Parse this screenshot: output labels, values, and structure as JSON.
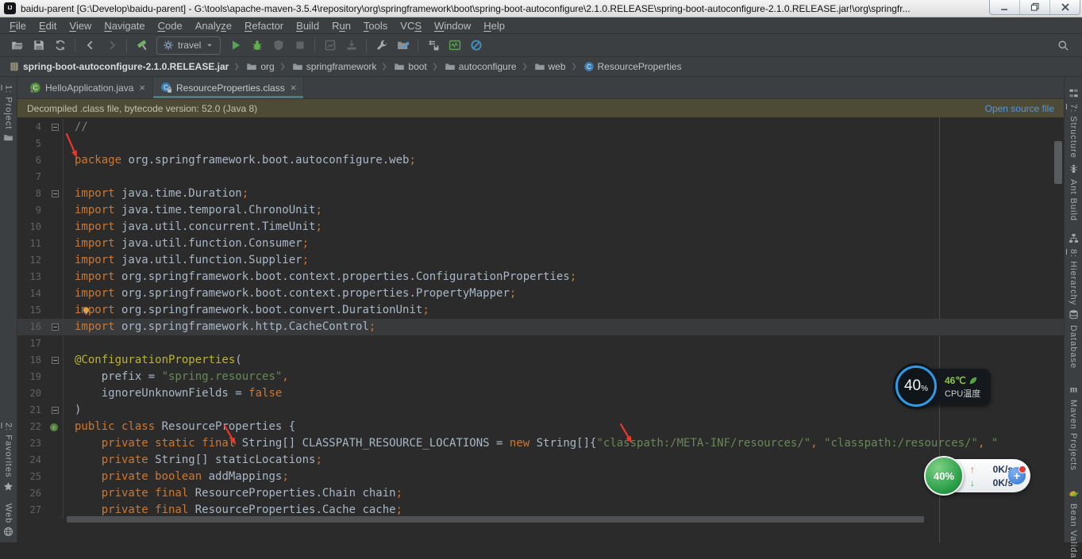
{
  "window": {
    "app_badge": "IJ",
    "title": "baidu-parent [G:\\Develop\\baidu-parent] - G:\\tools\\apache-maven-3.5.4\\repository\\org\\springframework\\boot\\spring-boot-autoconfigure\\2.1.0.RELEASE\\spring-boot-autoconfigure-2.1.0.RELEASE.jar!\\org\\springfr...",
    "controls": [
      "minimize",
      "maximize",
      "close"
    ]
  },
  "menu": {
    "items": [
      {
        "label": "File",
        "mnemonic_index": 0
      },
      {
        "label": "Edit",
        "mnemonic_index": 0
      },
      {
        "label": "View",
        "mnemonic_index": 0
      },
      {
        "label": "Navigate",
        "mnemonic_index": 0
      },
      {
        "label": "Code",
        "mnemonic_index": 0
      },
      {
        "label": "Analyze",
        "mnemonic_index": 5
      },
      {
        "label": "Refactor",
        "mnemonic_index": 0
      },
      {
        "label": "Build",
        "mnemonic_index": 0
      },
      {
        "label": "Run",
        "mnemonic_index": 1
      },
      {
        "label": "Tools",
        "mnemonic_index": 0
      },
      {
        "label": "VCS",
        "mnemonic_index": 2
      },
      {
        "label": "Window",
        "mnemonic_index": 0
      },
      {
        "label": "Help",
        "mnemonic_index": 0
      }
    ]
  },
  "toolbar": {
    "run_config_label": "travel",
    "items": [
      {
        "name": "open-project"
      },
      {
        "name": "save-all"
      },
      {
        "name": "synchronize"
      },
      {
        "sep": true
      },
      {
        "name": "back"
      },
      {
        "name": "forward",
        "enabled": false
      },
      {
        "sep": true
      },
      {
        "name": "build-hammer"
      },
      {
        "name": "run-config"
      },
      {
        "name": "run"
      },
      {
        "name": "debug"
      },
      {
        "name": "run-coverage",
        "enabled": false
      },
      {
        "name": "stop",
        "enabled": false
      },
      {
        "sep": true
      },
      {
        "name": "attach-profiler",
        "enabled": false
      },
      {
        "name": "thread-dump",
        "enabled": false
      },
      {
        "sep": true
      },
      {
        "name": "settings-wrench"
      },
      {
        "name": "project-structure"
      },
      {
        "sep": true
      },
      {
        "name": "push-settings"
      },
      {
        "name": "activity-monitor"
      },
      {
        "name": "disabled-plugins"
      }
    ],
    "search_icon": "search-everywhere"
  },
  "breadcrumbs": {
    "root": {
      "label": "spring-boot-autoconfigure-2.1.0.RELEASE.jar",
      "icon": "jar"
    },
    "folders": [
      "org",
      "springframework",
      "boot",
      "autoconfigure",
      "web"
    ],
    "leaf": {
      "label": "ResourceProperties",
      "icon": "class"
    }
  },
  "tabs": [
    {
      "label": "HelloApplication.java",
      "icon": "class-green",
      "active": false
    },
    {
      "label": "ResourceProperties.class",
      "icon": "class-blue-lock",
      "active": true
    }
  ],
  "banner": {
    "message": "Decompiled .class file, bytecode version: 52.0 (Java 8)",
    "action_label": "Open source file"
  },
  "editor": {
    "caret_line": 16,
    "lines": [
      {
        "n": 4,
        "fold": true,
        "tokens": [
          [
            "c",
            "//"
          ]
        ]
      },
      {
        "n": 5,
        "tokens": []
      },
      {
        "n": 6,
        "tokens": [
          [
            "k",
            "package"
          ],
          [
            "p",
            " org.springframework.boot.autoconfigure.web"
          ],
          [
            "o",
            ";"
          ]
        ]
      },
      {
        "n": 7,
        "tokens": []
      },
      {
        "n": 8,
        "fold": true,
        "tokens": [
          [
            "k",
            "import"
          ],
          [
            "p",
            " java.time.Duration"
          ],
          [
            "o",
            ";"
          ]
        ]
      },
      {
        "n": 9,
        "tokens": [
          [
            "k",
            "import"
          ],
          [
            "p",
            " java.time.temporal.ChronoUnit"
          ],
          [
            "o",
            ";"
          ]
        ]
      },
      {
        "n": 10,
        "tokens": [
          [
            "k",
            "import"
          ],
          [
            "p",
            " java.util.concurrent.TimeUnit"
          ],
          [
            "o",
            ";"
          ]
        ]
      },
      {
        "n": 11,
        "tokens": [
          [
            "k",
            "import"
          ],
          [
            "p",
            " java.util.function.Consumer"
          ],
          [
            "o",
            ";"
          ]
        ]
      },
      {
        "n": 12,
        "tokens": [
          [
            "k",
            "import"
          ],
          [
            "p",
            " java.util.function.Supplier"
          ],
          [
            "o",
            ";"
          ]
        ]
      },
      {
        "n": 13,
        "tokens": [
          [
            "k",
            "import"
          ],
          [
            "p",
            " org.springframework.boot.context.properties.ConfigurationProperties"
          ],
          [
            "o",
            ";"
          ]
        ]
      },
      {
        "n": 14,
        "tokens": [
          [
            "k",
            "import"
          ],
          [
            "p",
            " org.springframework.boot.context.properties.PropertyMapper"
          ],
          [
            "o",
            ";"
          ]
        ]
      },
      {
        "n": 15,
        "bulb": true,
        "tokens": [
          [
            "k",
            "import"
          ],
          [
            "p",
            " org.springframework.boot.convert.DurationUnit"
          ],
          [
            "o",
            ";"
          ]
        ]
      },
      {
        "n": 16,
        "fold": true,
        "tokens": [
          [
            "k",
            "import"
          ],
          [
            "p",
            " org.springframework.http.CacheControl"
          ],
          [
            "o",
            ";"
          ]
        ]
      },
      {
        "n": 17,
        "tokens": []
      },
      {
        "n": 18,
        "fold": true,
        "tokens": [
          [
            "a",
            "@ConfigurationProperties"
          ],
          [
            "p",
            "("
          ]
        ]
      },
      {
        "n": 19,
        "tokens": [
          [
            "p",
            "    prefix = "
          ],
          [
            "s",
            "\"spring.resources\""
          ],
          [
            "o",
            ","
          ]
        ]
      },
      {
        "n": 20,
        "tokens": [
          [
            "p",
            "    ignoreUnknownFields = "
          ],
          [
            "k",
            "false"
          ]
        ]
      },
      {
        "n": 21,
        "fold": true,
        "tokens": [
          [
            "p",
            ")"
          ]
        ]
      },
      {
        "n": 22,
        "gutter_icon": "class",
        "tokens": [
          [
            "k",
            "public class"
          ],
          [
            "p",
            " ResourceProperties {"
          ]
        ]
      },
      {
        "n": 23,
        "tokens": [
          [
            "k",
            "    private static final"
          ],
          [
            "p",
            " String[] CLASSPATH_RESOURCE_LOCATIONS = "
          ],
          [
            "k",
            "new"
          ],
          [
            "p",
            " String[]{"
          ],
          [
            "s",
            "\"classpath:/META-INF/resources/\""
          ],
          [
            "o",
            ","
          ],
          [
            "p",
            " "
          ],
          [
            "s",
            "\"classpath:/resources/\""
          ],
          [
            "o",
            ","
          ],
          [
            "p",
            " "
          ],
          [
            "s",
            "\""
          ]
        ]
      },
      {
        "n": 24,
        "tokens": [
          [
            "k",
            "    private"
          ],
          [
            "p",
            " String[] staticLocations"
          ],
          [
            "o",
            ";"
          ]
        ]
      },
      {
        "n": 25,
        "tokens": [
          [
            "k",
            "    private boolean"
          ],
          [
            "p",
            " addMappings"
          ],
          [
            "o",
            ";"
          ]
        ]
      },
      {
        "n": 26,
        "tokens": [
          [
            "k",
            "    private final"
          ],
          [
            "p",
            " ResourceProperties.Chain chain"
          ],
          [
            "o",
            ";"
          ]
        ]
      },
      {
        "n": 27,
        "tokens": [
          [
            "k",
            "    private final"
          ],
          [
            "p",
            " ResourceProperties.Cache cache"
          ],
          [
            "o",
            ";"
          ]
        ]
      }
    ]
  },
  "tool_stripes": {
    "left_top": [
      {
        "label": "1: Project",
        "icon": "folder"
      }
    ],
    "left_bottom": [
      {
        "label": "2: Favorites",
        "icon": "star"
      },
      {
        "label": "Web",
        "icon": "globe"
      }
    ],
    "right": [
      {
        "label": "7: Structure",
        "icon": "structure"
      },
      {
        "label": "Ant Build",
        "icon": "ant"
      },
      {
        "label": "8: Hierarchy",
        "icon": "hierarchy"
      },
      {
        "label": "Database",
        "icon": "database"
      },
      {
        "label": "Maven Projects",
        "icon": "maven"
      },
      {
        "label": "Bean Valida",
        "icon": "bean"
      }
    ]
  },
  "overlays": {
    "cpu_widget": {
      "percent": "40",
      "percent_sign": "%",
      "temperature": "46℃",
      "label": "CPU温度"
    },
    "net_widget": {
      "percent": "40%",
      "upload": "0K/s",
      "download": "0K/s"
    }
  },
  "colors": {
    "editor_bg": "#2B2B2B",
    "panel_bg": "#3C3F41",
    "keyword": "#CC7832",
    "string": "#6A8759",
    "annotation": "#BBB529",
    "comment": "#808080",
    "plain_text": "#A9B7C6",
    "banner_bg": "#4D4B35",
    "link": "#5394EC",
    "active_tab_underline": "#4D7C7C",
    "caret_line_bg": "#383A3C",
    "cpu_ring": "#2F9BE8",
    "temp_green": "#8CC63F",
    "arrow_red": "#E8392B"
  }
}
